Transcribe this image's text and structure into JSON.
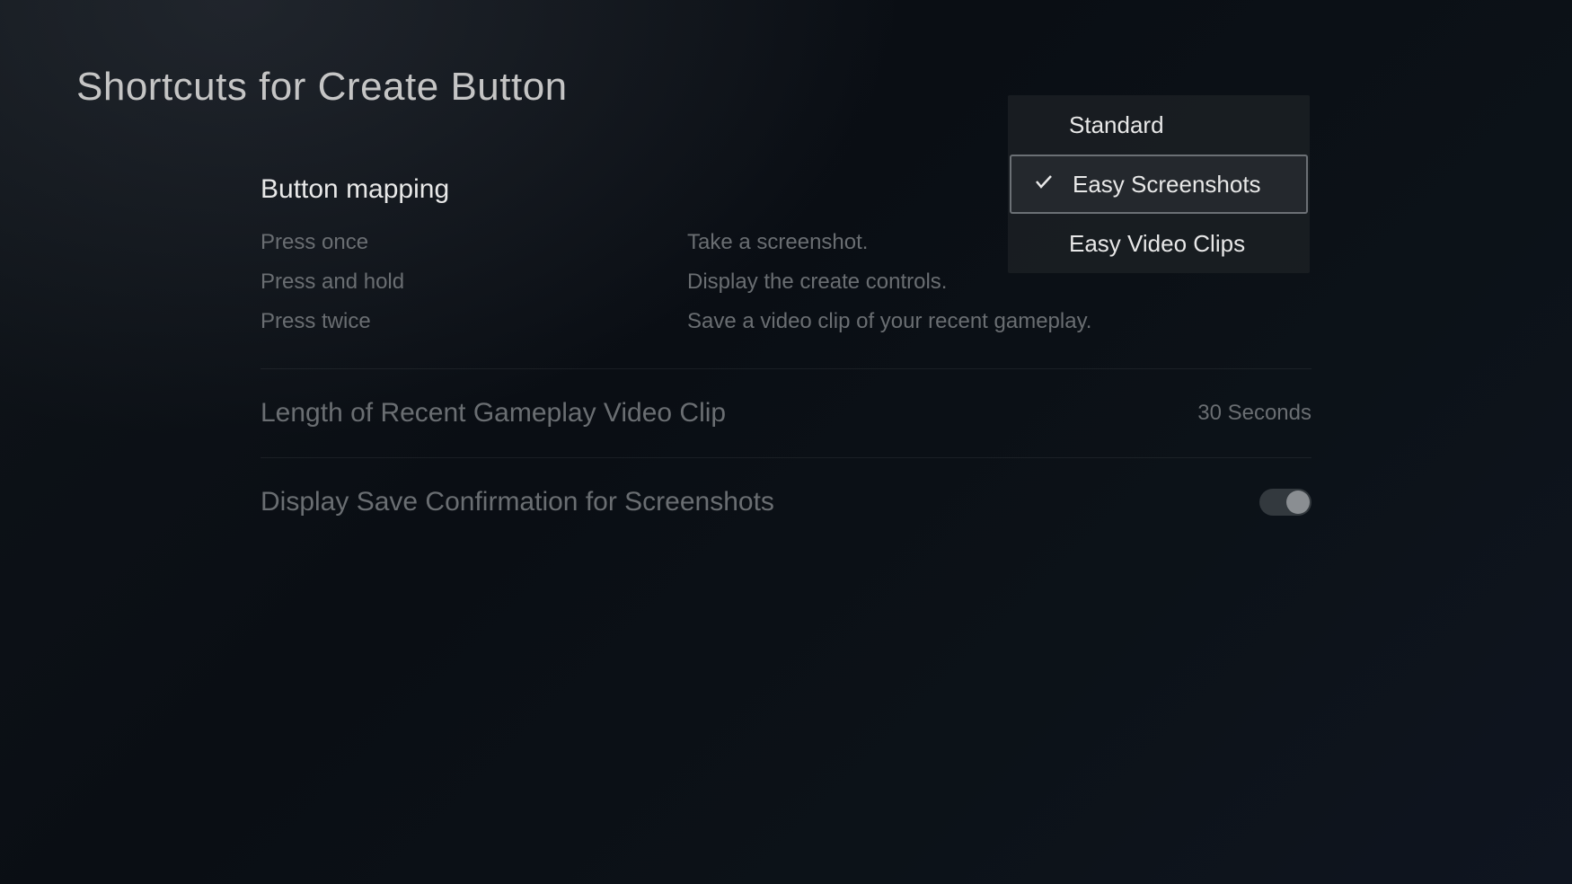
{
  "page_title": "Shortcuts for Create Button",
  "sections": {
    "button_mapping": {
      "title": "Button mapping",
      "rows": [
        {
          "action": "Press once",
          "description": "Take a screenshot."
        },
        {
          "action": "Press and hold",
          "description": "Display the create controls."
        },
        {
          "action": "Press twice",
          "description": "Save a video clip of your recent gameplay."
        }
      ]
    },
    "video_clip_length": {
      "label": "Length of Recent Gameplay Video Clip",
      "value": "30 Seconds"
    },
    "save_confirmation": {
      "label": "Display Save Confirmation for Screenshots",
      "enabled": true
    }
  },
  "dropdown": {
    "items": [
      {
        "label": "Standard",
        "selected": false
      },
      {
        "label": "Easy Screenshots",
        "selected": true
      },
      {
        "label": "Easy Video Clips",
        "selected": false
      }
    ]
  }
}
